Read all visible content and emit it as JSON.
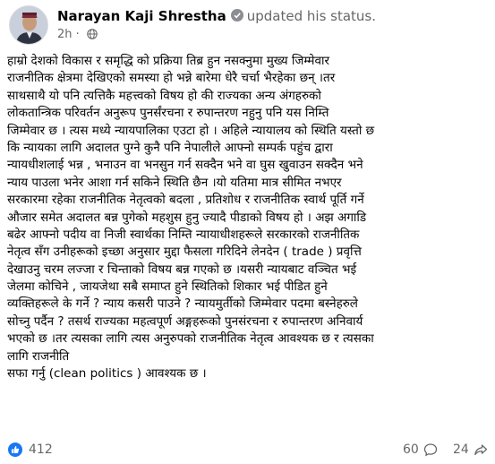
{
  "post": {
    "author": "Narayan Kaji Shrestha",
    "action": "updated his status.",
    "time": "2h",
    "body_lines": [
      "हाम्रो देशको विकास र समृद्धि को प्रक्रिया तिब्र हुन नसक्नुमा मुख्य जिम्मेवार",
      "राजनीतिक क्षेत्रमा देखिएको समस्या हो भन्ने बारेमा धेरै चर्चा भैरहेका छन् ।तर",
      "साथसाथै यो पनि त्यत्तिकै महत्त्वको विषय हो  की राज्यका अन्य अंगहरुको",
      "लोकतान्त्रिक परिवर्तन अनुरूप पुनर्संरचना र रुपान्तरण नहुनु पनि यस निम्ति",
      "जिम्मेवार छ । त्यस मध्ये न्यायपालिका एउटा हो । अहिले न्यायालय को स्थिति यस्तो छ",
      "कि न्यायका लागि अदालत पुग्ने कुनै पनि नेपालीले आफ्नो सम्पर्क पहुंच द्वारा",
      "न्यायधीशलाई भन्न , भनाउन वा भनसुन गर्न सक्दैन भने वा घुस खुवाउन सक्दैन भने",
      "न्याय पाउला भनेर आशा गर्न सकिने स्थिति छैन ।यो यतिमा मात्र सीमित नभएर",
      "सरकारमा रहेका राजनीतिक नेतृत्वको  बदला , प्रतिशोध र राजनीतिक स्वार्थ पूर्ति गर्ने",
      "औजार समेत अदालत बन्न पुगेको महशुस हुनु ज्यादै पीडाको विषय हो । अझ अगाडि",
      "बढेर आफ्नो पदीय वा निजी स्वार्थका निम्ति न्यायाधीशहरूले सरकारको राजनीतिक",
      "नेतृत्व सँग उनीहरूको इच्छा अनुसार मुद्दा फैसला गरिदिने लेनदेन ( trade ) प्रवृत्ति",
      "देखाउनु चरम लज्जा र चिन्ताको विषय बन्न गएको छ ।यसरी न्यायबाट वञ्चित भई",
      "जेलमा कोचिने , जायजेथा सबै समाप्त हुने स्थितिको शिकार भई पीडित हुने",
      "व्यक्तिहरूले के गर्ने ? न्याय कसरी पाउने ? न्यायमुर्तीको जिम्मेवार पदमा बस्नेहरुले",
      "सोच्नु पर्दैन ? तसर्थ राज्यका महत्वपूर्ण अङ्गहरूको पुनसंरचना र रुपान्तरण अनिवार्य",
      "भएको छ ।तर त्यसका लागि त्यस अनुरुपको राजनीतिक नेतृत्व आवश्यक छ र त्यसका",
      "लागि राजनीति",
      "सफा गर्नु (clean politics ) आवश्यक छ ।"
    ]
  },
  "stats": {
    "reactions": "412",
    "comments": "60",
    "shares": "24"
  },
  "icons": {
    "verified": "verified-badge-icon",
    "privacy": "globe-icon",
    "reaction": "like-icon",
    "comment": "comment-icon",
    "share": "share-icon"
  },
  "colors": {
    "like_blue": "#1877f2",
    "meta_gray": "#65676b",
    "text": "#050505"
  }
}
